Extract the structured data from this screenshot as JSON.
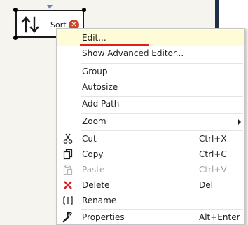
{
  "node": {
    "label": "Sort",
    "error_glyph": "✕",
    "icon": "sort-arrows-icon",
    "badge_color": "#c9482b"
  },
  "menu": {
    "items": [
      {
        "label": "Edit...",
        "highlighted": true
      },
      {
        "label": "Show Advanced Editor..."
      },
      {
        "label": "Group"
      },
      {
        "label": "Autosize"
      },
      {
        "label": "Add Path"
      },
      {
        "label": "Zoom",
        "submenu": true
      },
      {
        "label": "Cut",
        "shortcut": "Ctrl+X",
        "icon": "scissors-icon"
      },
      {
        "label": "Copy",
        "shortcut": "Ctrl+C",
        "icon": "copy-icon"
      },
      {
        "label": "Paste",
        "shortcut": "Ctrl+V",
        "icon": "paste-icon",
        "disabled": true
      },
      {
        "label": "Delete",
        "shortcut": "Del",
        "icon": "delete-x-icon"
      },
      {
        "label": "Rename",
        "icon": "rename-icon"
      },
      {
        "label": "Properties",
        "shortcut": "Alt+Enter",
        "icon": "wrench-icon"
      }
    ]
  },
  "colors": {
    "highlight": "#fefbd7",
    "accent_underline": "#e02020",
    "connector": "#6d7fb5",
    "delete": "#d42020"
  }
}
